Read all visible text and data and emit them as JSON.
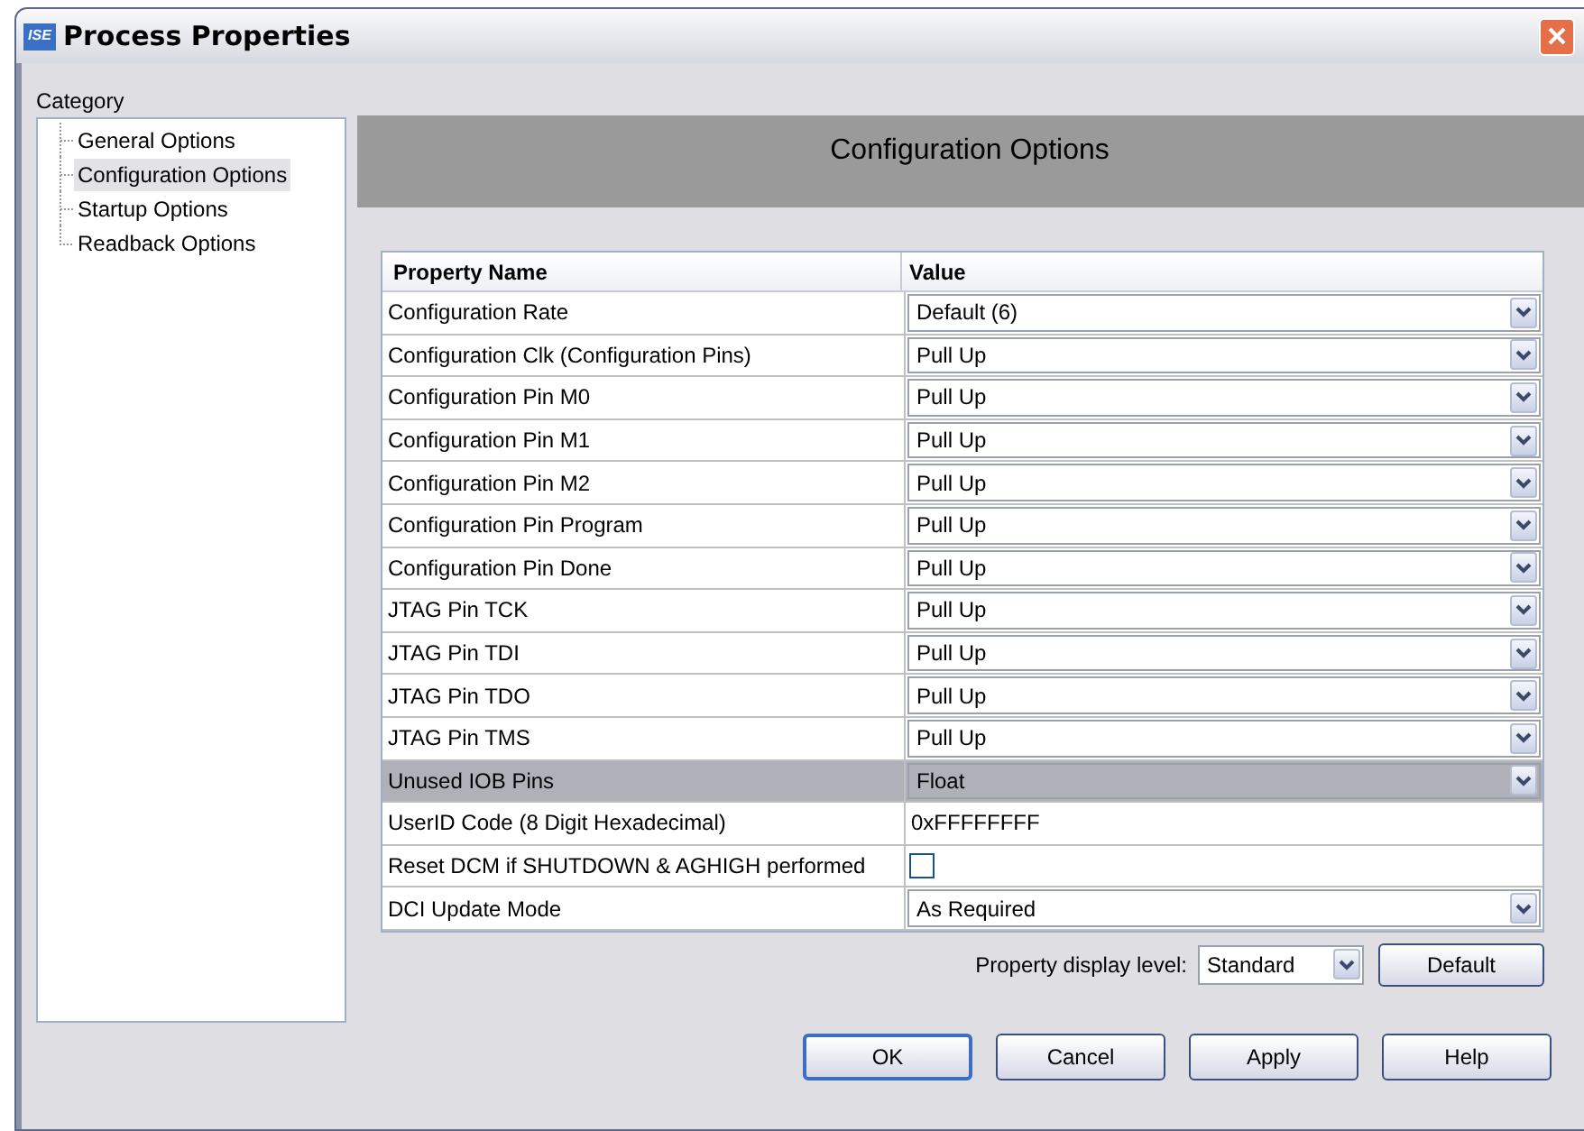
{
  "window": {
    "title": "Process Properties",
    "logo": "ISE"
  },
  "category": {
    "label": "Category",
    "items": [
      {
        "label": "General Options",
        "selected": false
      },
      {
        "label": "Configuration Options",
        "selected": true
      },
      {
        "label": "Startup Options",
        "selected": false
      },
      {
        "label": "Readback Options",
        "selected": false
      }
    ]
  },
  "panel": {
    "title": "Configuration Options"
  },
  "table": {
    "columns": [
      "Property Name",
      "Value"
    ],
    "rows": [
      {
        "name": "Configuration Rate",
        "kind": "dropdown",
        "value": "Default (6)",
        "selected": false
      },
      {
        "name": "Configuration Clk (Configuration Pins)",
        "kind": "dropdown",
        "value": "Pull Up",
        "selected": false
      },
      {
        "name": "Configuration Pin M0",
        "kind": "dropdown",
        "value": "Pull Up",
        "selected": false
      },
      {
        "name": "Configuration Pin M1",
        "kind": "dropdown",
        "value": "Pull Up",
        "selected": false
      },
      {
        "name": "Configuration Pin M2",
        "kind": "dropdown",
        "value": "Pull Up",
        "selected": false
      },
      {
        "name": "Configuration Pin Program",
        "kind": "dropdown",
        "value": "Pull Up",
        "selected": false
      },
      {
        "name": "Configuration Pin Done",
        "kind": "dropdown",
        "value": "Pull Up",
        "selected": false
      },
      {
        "name": "JTAG Pin TCK",
        "kind": "dropdown",
        "value": "Pull Up",
        "selected": false
      },
      {
        "name": "JTAG Pin TDI",
        "kind": "dropdown",
        "value": "Pull Up",
        "selected": false
      },
      {
        "name": "JTAG Pin TDO",
        "kind": "dropdown",
        "value": "Pull Up",
        "selected": false
      },
      {
        "name": "JTAG Pin TMS",
        "kind": "dropdown",
        "value": "Pull Up",
        "selected": false
      },
      {
        "name": "Unused IOB Pins",
        "kind": "dropdown",
        "value": "Float",
        "selected": true
      },
      {
        "name": "UserID Code (8 Digit Hexadecimal)",
        "kind": "text",
        "value": "0xFFFFFFFF",
        "selected": false
      },
      {
        "name": "Reset DCM if SHUTDOWN & AGHIGH performed",
        "kind": "checkbox",
        "checked": false,
        "selected": false
      },
      {
        "name": "DCI Update Mode",
        "kind": "dropdown",
        "value": "As Required",
        "selected": false
      }
    ]
  },
  "display_level": {
    "label": "Property display level:",
    "value": "Standard",
    "button": "Default"
  },
  "buttons": [
    "OK",
    "Cancel",
    "Apply",
    "Help"
  ]
}
